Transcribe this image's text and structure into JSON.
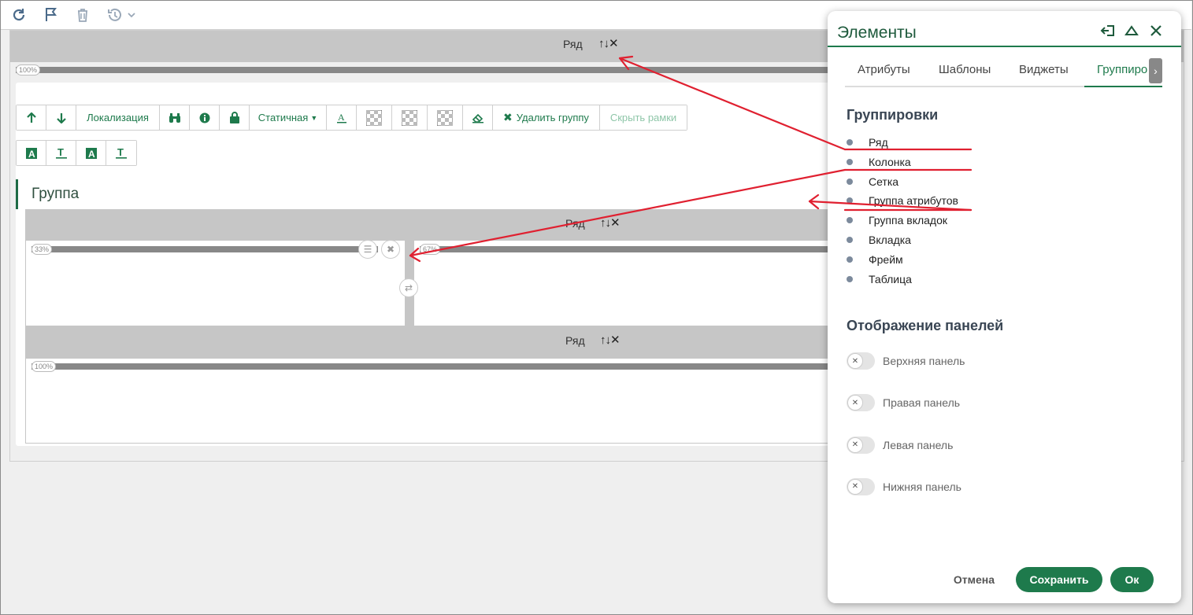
{
  "toolbar": {
    "icons": [
      "refresh-icon",
      "flag-icon",
      "trash-icon",
      "history-icon"
    ]
  },
  "editor": {
    "top_row": {
      "label": "Ряд",
      "width_pct": "100%"
    },
    "buttons_row1": {
      "localization": "Локализация",
      "static": "Статичная",
      "delete_group": "Удалить группу",
      "hide_frames": "Скрыть рамки"
    },
    "group_title": "Группа",
    "inner_row1": {
      "label": "Ряд",
      "left_pct": "33%",
      "right_pct": "67%"
    },
    "inner_row2": {
      "label": "Ряд",
      "width_pct": "100%"
    },
    "row_controls": "↑↓✕"
  },
  "panel": {
    "title": "Элементы",
    "tabs": [
      "Атрибуты",
      "Шаблоны",
      "Виджеты",
      "Группиро"
    ],
    "active_tab": 3,
    "groupings_title": "Группировки",
    "groupings": [
      "Ряд",
      "Колонка",
      "Сетка",
      "Группа атрибутов",
      "Группа вкладок",
      "Вкладка",
      "Фрейм",
      "Таблица"
    ],
    "panels_title": "Отображение панелей",
    "toggles": [
      "Верхняя панель",
      "Правая панель",
      "Левая панель",
      "Нижняя панель"
    ],
    "cancel": "Отмена",
    "save": "Сохранить",
    "ok": "Ок"
  },
  "colors": {
    "accent": "#1e7a4c",
    "annotation": "#e02030"
  }
}
